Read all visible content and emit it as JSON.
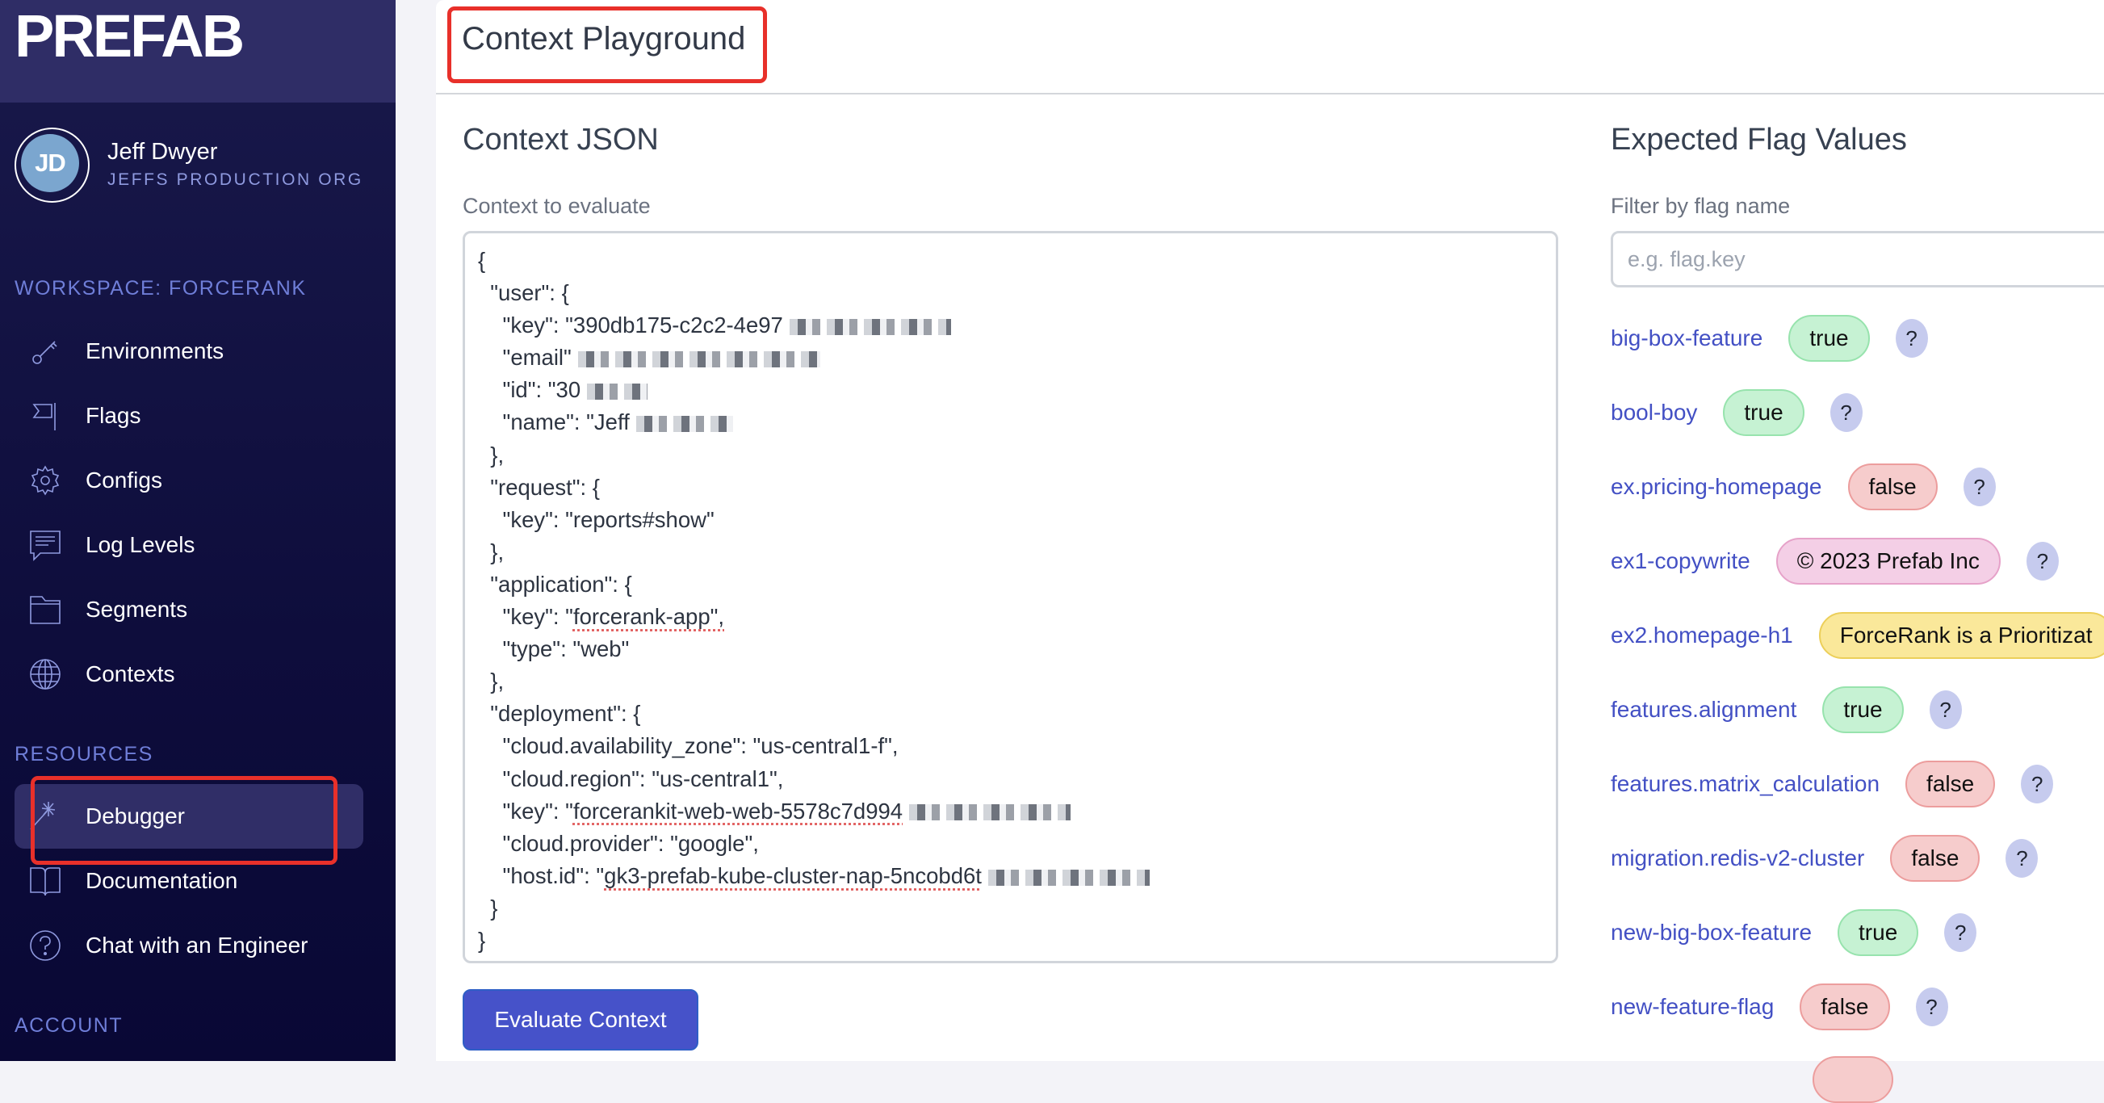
{
  "sidebar": {
    "logo_text": "PREFAB",
    "user": {
      "initials": "JD",
      "name": "Jeff Dwyer",
      "org": "JEFFS PRODUCTION ORG"
    },
    "workspace_label": "WORKSPACE: FORCERANK",
    "workspace_items": [
      {
        "label": "Environments",
        "icon": "key-icon"
      },
      {
        "label": "Flags",
        "icon": "flag-icon"
      },
      {
        "label": "Configs",
        "icon": "gear-icon"
      },
      {
        "label": "Log Levels",
        "icon": "chat-bubble-icon"
      },
      {
        "label": "Segments",
        "icon": "folder-icon"
      },
      {
        "label": "Contexts",
        "icon": "globe-icon"
      }
    ],
    "resources_label": "RESOURCES",
    "resource_items": [
      {
        "label": "Debugger",
        "icon": "magic-wand-icon",
        "active": true
      },
      {
        "label": "Documentation",
        "icon": "book-icon"
      },
      {
        "label": "Chat with an Engineer",
        "icon": "question-circle-icon"
      }
    ],
    "account_label": "ACCOUNT"
  },
  "main": {
    "page_title": "Context Playground",
    "context_json": {
      "heading": "Context JSON",
      "field_label": "Context to evaluate",
      "lines": [
        {
          "text": "{"
        },
        {
          "text": "  \"user\": {"
        },
        {
          "text": "    \"key\": \"390db175-c2c2-4e97",
          "redacted": true
        },
        {
          "text": "    \"email\"",
          "redacted": true
        },
        {
          "text": "    \"id\": \"30",
          "redacted": true
        },
        {
          "text": "    \"name\": \"Jeff",
          "redacted": true
        },
        {
          "text": "  },"
        },
        {
          "text": "  \"request\": {"
        },
        {
          "text": "    \"key\": \"reports#show\""
        },
        {
          "text": "  },"
        },
        {
          "text": "  \"application\": {"
        },
        {
          "text": "    \"key\": \"forcerank-app\","
        },
        {
          "text": "    \"type\": \"web\""
        },
        {
          "text": "  },"
        },
        {
          "text": "  \"deployment\": {"
        },
        {
          "text": "    \"cloud.availability_zone\": \"us-central1-f\","
        },
        {
          "text": "    \"cloud.region\": \"us-central1\","
        },
        {
          "text": "    \"key\": \"forcerankit-web-web-5578c7d994",
          "redacted": true
        },
        {
          "text": "    \"cloud.provider\": \"google\","
        },
        {
          "text": "    \"host.id\": \"gk3-prefab-kube-cluster-nap-5ncobd6t",
          "redacted": true
        },
        {
          "text": "  }"
        },
        {
          "text": "}"
        }
      ],
      "button_label": "Evaluate Context"
    },
    "flags": {
      "heading": "Expected Flag Values",
      "filter_label": "Filter by flag name",
      "filter_placeholder": "e.g. flag.key",
      "filter_value": "",
      "help_glyph": "?",
      "items": [
        {
          "name": "big-box-feature",
          "value": "true",
          "kind": "true"
        },
        {
          "name": "bool-boy",
          "value": "true",
          "kind": "true"
        },
        {
          "name": "ex.pricing-homepage",
          "value": "false",
          "kind": "false"
        },
        {
          "name": "ex1-copywrite",
          "value": "© 2023 Prefab Inc",
          "kind": "pink"
        },
        {
          "name": "ex2.homepage-h1",
          "value": "ForceRank is a Prioritizat",
          "kind": "yellow"
        },
        {
          "name": "features.alignment",
          "value": "true",
          "kind": "true"
        },
        {
          "name": "features.matrix_calculation",
          "value": "false",
          "kind": "false"
        },
        {
          "name": "migration.redis-v2-cluster",
          "value": "false",
          "kind": "false"
        },
        {
          "name": "new-big-box-feature",
          "value": "true",
          "kind": "true"
        },
        {
          "name": "new-feature-flag",
          "value": "false",
          "kind": "false"
        }
      ]
    }
  },
  "colors": {
    "sidebar_header": "#2f2d66",
    "sidebar_bg": "#16164a",
    "accent_text": "#8f9adf",
    "section_label": "#6f7ed8",
    "link": "#4350c4",
    "button": "#4652c9",
    "annotation": "#e8302a"
  }
}
